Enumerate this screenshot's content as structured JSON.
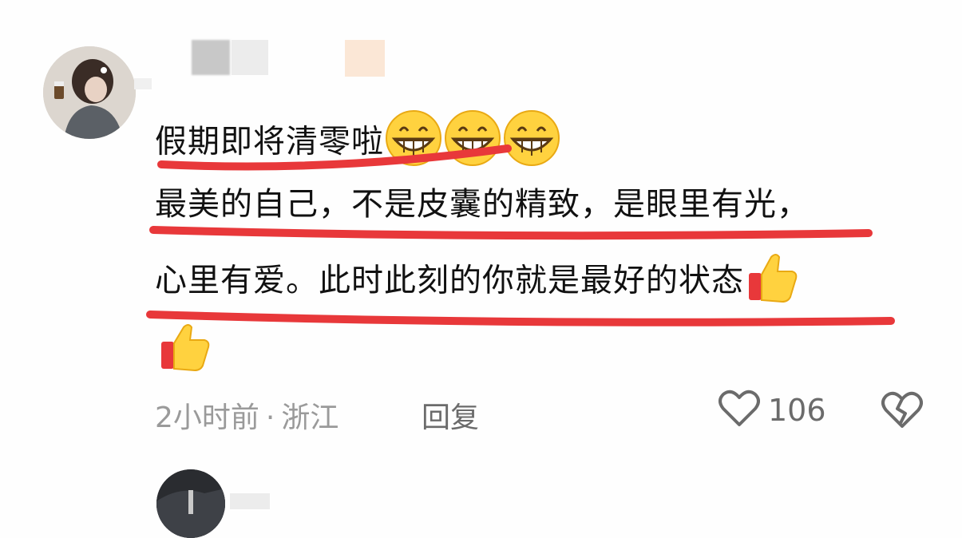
{
  "comment": {
    "username_blurred": true,
    "lines": [
      "假期即将清零啦",
      "最美的自己，不是皮囊的精致，是眼里有光，",
      "心里有爱。此时此刻的你就是最好的状态"
    ],
    "emoji_row1": [
      "grinning-face",
      "grinning-face",
      "grinning-face"
    ],
    "emoji_row3": "thumbs-up",
    "emoji_row4": "thumbs-up",
    "time": "2小时前",
    "separator": "·",
    "location": "浙江",
    "reply_label": "回复",
    "like_count": "106"
  },
  "colors": {
    "underline": "#e8383a",
    "meta_text": "#9a9a9a",
    "icon": "#6b6b6b"
  }
}
